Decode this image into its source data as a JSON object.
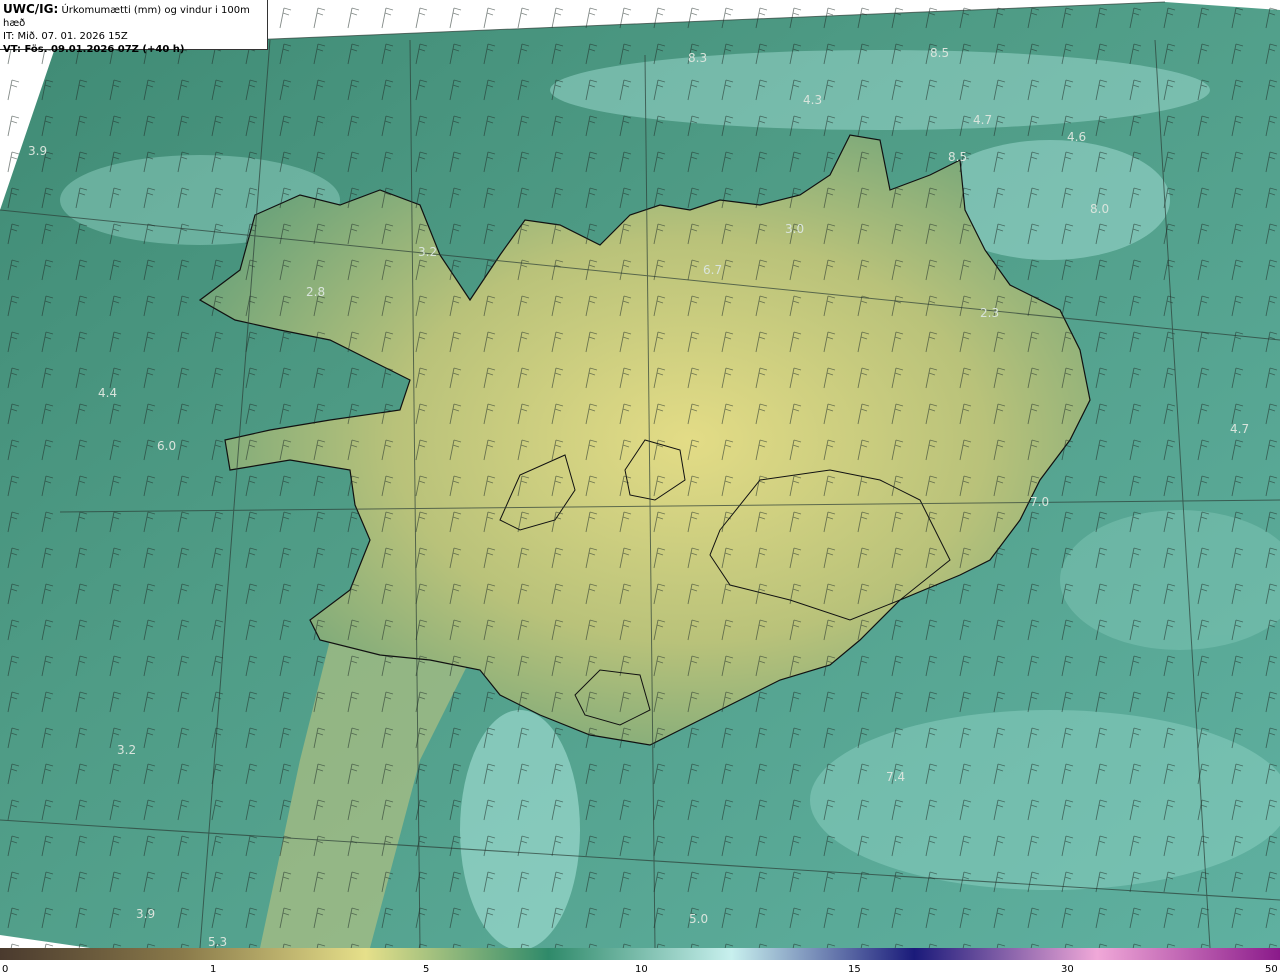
{
  "header": {
    "product": "UWC/IG:",
    "title": "Úrkomumætti (mm) og vindur i 100m hæð",
    "issue_time": "IT: Mið. 07. 01. 2026 15Z",
    "valid_time": "VT: Fös. 09.01.2026 07Z (+40 h)"
  },
  "map_values": [
    "8.3",
    "4.3",
    "8.5",
    "4.7",
    "4.6",
    "3.9",
    "8.5",
    "8.0",
    "3.2",
    "3.0",
    "6.7",
    "2.8",
    "2.3",
    "4.4",
    "6.0",
    "4.7",
    "7.0",
    "3.2",
    "7.4",
    "3.9",
    "5.0",
    "5.3"
  ],
  "colorbar": {
    "ticks": [
      "0",
      "1",
      "5",
      "10",
      "15",
      "30",
      "50"
    ],
    "colors": [
      "#4a3a2e",
      "#8a7a4a",
      "#e6e08a",
      "#2f8a6a",
      "#c8f0ee",
      "#1a1a7a",
      "#f0a8d8",
      "#8a1a8a"
    ]
  }
}
